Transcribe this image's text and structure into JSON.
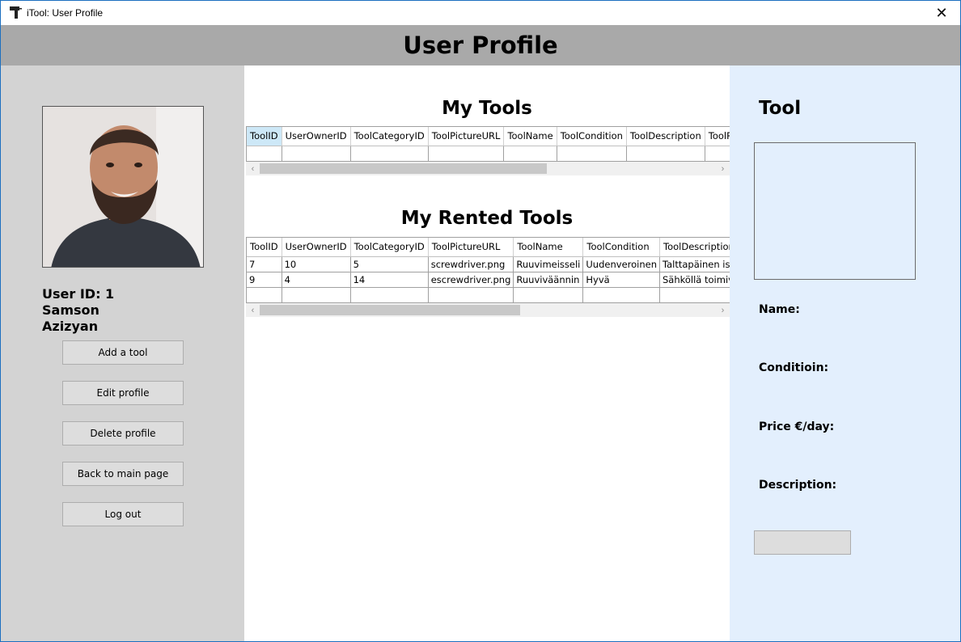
{
  "window": {
    "title": "iTool: User Profile",
    "close_glyph": "✕"
  },
  "header": {
    "title": "User Profile"
  },
  "profile": {
    "user_id_line": "User ID: 1",
    "first_name": "Samson",
    "last_name": "Azizyan"
  },
  "actions": {
    "add_tool": "Add a tool",
    "edit_profile": "Edit profile",
    "delete_profile": "Delete profile",
    "back_to_main": "Back to main page",
    "log_out": "Log out"
  },
  "my_tools": {
    "title": "My Tools",
    "columns": [
      "ToolID",
      "UserOwnerID",
      "ToolCategoryID",
      "ToolPictureURL",
      "ToolName",
      "ToolCondition",
      "ToolDescription",
      "ToolPric"
    ],
    "rows": [
      [
        "",
        "",
        "",
        "",
        "",
        "",
        "",
        ""
      ]
    ]
  },
  "rented_tools": {
    "title": "My Rented Tools",
    "columns": [
      "ToolID",
      "UserOwnerID",
      "ToolCategoryID",
      "ToolPictureURL",
      "ToolName",
      "ToolCondition",
      "ToolDescription"
    ],
    "rows": [
      [
        "7",
        "10",
        "5",
        "screwdriver.png",
        "Ruuvimeisseli",
        "Uudenveroinen",
        "Talttapäinen iso meis"
      ],
      [
        "9",
        "4",
        "14",
        "escrewdriver.png",
        "Ruuviväännin",
        "Hyvä",
        "Sähköllä toimiva ruuv"
      ],
      [
        "",
        "",
        "",
        "",
        "",
        "",
        ""
      ]
    ]
  },
  "tool_detail": {
    "heading": "Tool",
    "name_label": "Name:",
    "condition_label": "Conditioin:",
    "price_label": "Price €/day:",
    "description_label": "Description:"
  },
  "colors": {
    "header_band": "#a9a9a9",
    "left_panel": "#d3d3d3",
    "right_panel": "#e3effd",
    "selected_header": "#cde8f7",
    "window_border": "#1c6fbf"
  },
  "icons": {
    "app": "drill-icon",
    "close": "close-icon",
    "scroll_left": "chevron-left-icon",
    "scroll_right": "chevron-right-icon"
  }
}
